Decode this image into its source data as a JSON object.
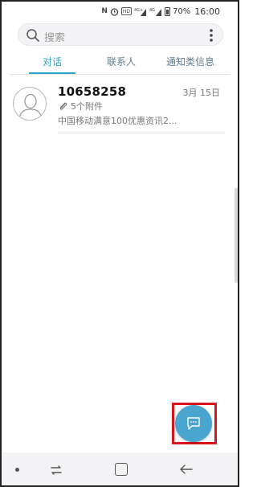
{
  "status_bar": {
    "icons": [
      "nfc-icon",
      "alarm-icon",
      "hd-icon",
      "4g-signal-icon",
      "4g-signal-icon",
      "battery-icon"
    ],
    "nfc_label": "N",
    "hd_label": "HD",
    "sig1_label": "4G+",
    "sig2_label": "4G",
    "battery": "70%",
    "time": "16:00"
  },
  "search": {
    "placeholder": "搜索"
  },
  "tabs": [
    {
      "label": "对话",
      "active": true
    },
    {
      "label": "联系人",
      "active": false
    },
    {
      "label": "通知类信息",
      "active": false
    }
  ],
  "conversations": [
    {
      "sender": "10658258",
      "date": "3月 15日",
      "attachment": "5个附件",
      "preview": "中国移动满意100优惠资讯2..."
    }
  ],
  "colors": {
    "accent": "#2aa4c6",
    "fab": "#4aa6cf",
    "highlight": "#d8141c"
  }
}
